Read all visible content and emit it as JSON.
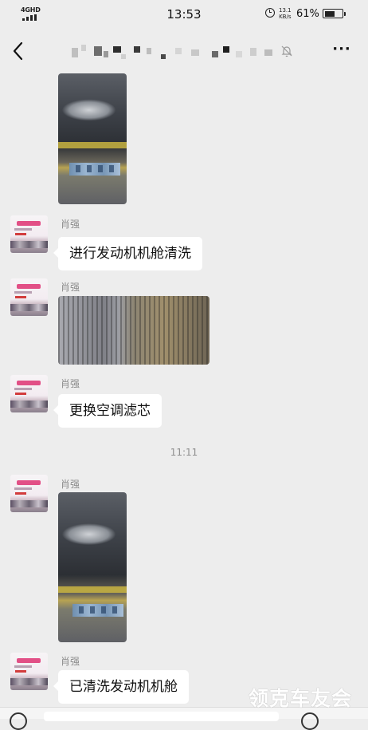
{
  "status_bar": {
    "network": "4GHD",
    "time": "13:53",
    "net_speed_value": "13.1",
    "net_speed_unit": "KB/s",
    "battery_text": "61%",
    "battery_level": 0.61
  },
  "nav": {
    "back_icon": "chevron-left-icon",
    "mute_icon": "bell-off-icon",
    "more_label": "···"
  },
  "messages": [
    {
      "type": "image",
      "sender": "",
      "subject": "engine-bay"
    },
    {
      "type": "text",
      "sender": "肖强",
      "text": "进行发动机机舱清洗"
    },
    {
      "type": "image",
      "sender": "肖强",
      "subject": "cabin-air-filter"
    },
    {
      "type": "text",
      "sender": "肖强",
      "text": "更换空调滤芯"
    },
    {
      "type": "time",
      "text": "11:11"
    },
    {
      "type": "image",
      "sender": "肖强",
      "subject": "engine-bay"
    },
    {
      "type": "text",
      "sender": "肖强",
      "text": "已清洗发动机机舱"
    }
  ],
  "watermark": "领克车友会",
  "colors": {
    "background": "#ededed",
    "bubble": "#ffffff",
    "name_text": "#8a8a8a",
    "avatar_accent": "#e24f86"
  }
}
